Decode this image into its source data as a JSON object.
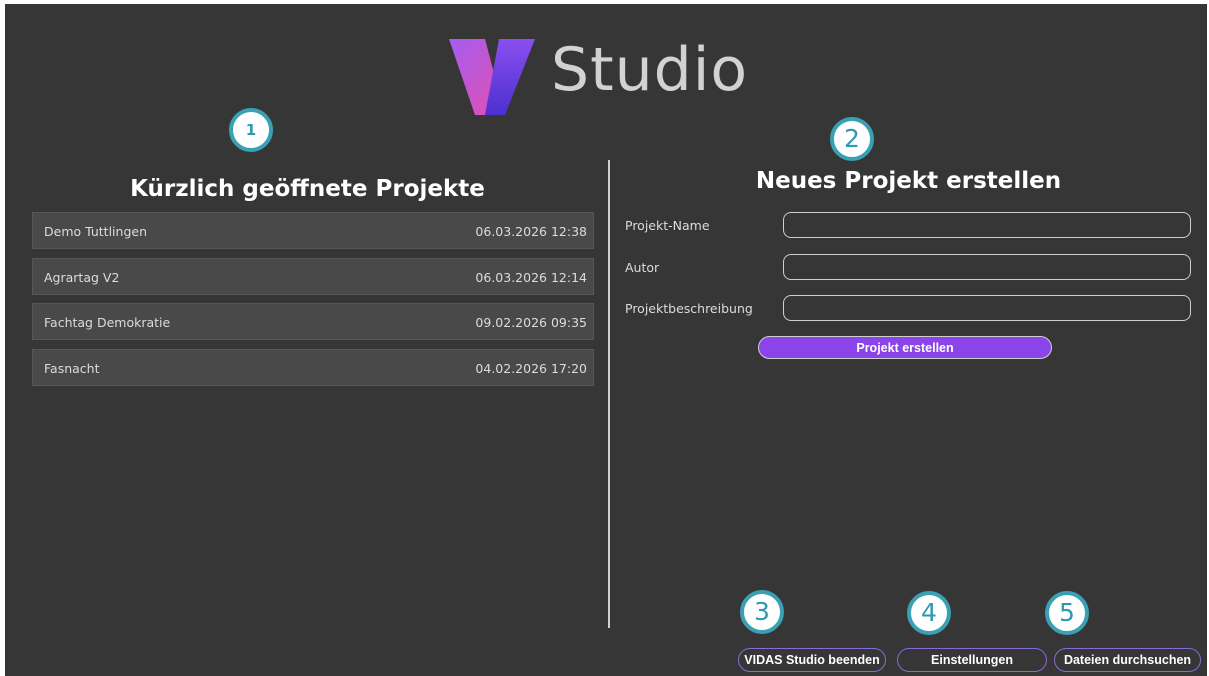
{
  "app": {
    "logo_text": "Studio",
    "colors": {
      "background": "#363636",
      "accent": "#8b44ea",
      "badge": "#3aa1b4"
    }
  },
  "recent": {
    "title": "Kürzlich geöffnete Projekte",
    "items": [
      {
        "name": "Demo Tuttlingen",
        "date": "06.03.2026 12:38"
      },
      {
        "name": "Agrartag V2",
        "date": "06.03.2026 12:14"
      },
      {
        "name": "Fachtag Demokratie",
        "date": "09.02.2026 09:35"
      },
      {
        "name": "Fasnacht",
        "date": "04.02.2026 17:20"
      }
    ]
  },
  "new_project": {
    "title": "Neues Projekt erstellen",
    "fields": [
      {
        "label": "Projekt-Name",
        "value": ""
      },
      {
        "label": "Autor",
        "value": ""
      },
      {
        "label": "Projektbeschreibung",
        "value": ""
      }
    ],
    "create_label": "Projekt erstellen"
  },
  "footer": {
    "quit_label": "VIDAS Studio beenden",
    "settings_label": "Einstellungen",
    "browse_label": "Dateien durchsuchen"
  },
  "badges": [
    "1",
    "2",
    "3",
    "4",
    "5"
  ]
}
